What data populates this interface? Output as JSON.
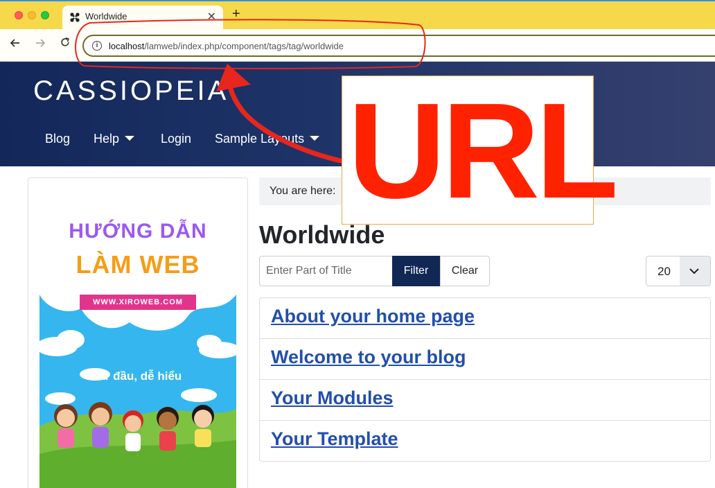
{
  "browser": {
    "tab_title": "Worldwide",
    "tab_close": "✕",
    "new_tab": "+",
    "url_host": "localhost",
    "url_path": "/lamweb/index.php/component/tags/tag/worldwide",
    "back_icon": "arrow-left-icon",
    "forward_icon": "arrow-right-icon",
    "reload_icon": "reload-icon"
  },
  "site": {
    "brand": "CASSIOPEIA",
    "menu": [
      {
        "label": "Blog",
        "dropdown": false
      },
      {
        "label": "Help",
        "dropdown": true
      },
      {
        "label": "Login",
        "dropdown": false
      },
      {
        "label": "Sample Layouts",
        "dropdown": true
      }
    ]
  },
  "ad": {
    "line1": "HƯỚNG DẪN",
    "line2": "LÀM WEB",
    "ribbon": "WWW.XIROWEB.COM",
    "tagline": "Từ đầu, dễ hiểu"
  },
  "main": {
    "breadcrumb_prefix": "You are here:",
    "title": "Worldwide",
    "filter_placeholder": "Enter Part of Title",
    "filter_button": "Filter",
    "clear_button": "Clear",
    "limit_value": "20",
    "items": [
      "About your home page",
      "Welcome to your blog",
      "Your Modules",
      "Your Template"
    ]
  },
  "annotation": {
    "label": "URL",
    "color": "#ff2200"
  }
}
